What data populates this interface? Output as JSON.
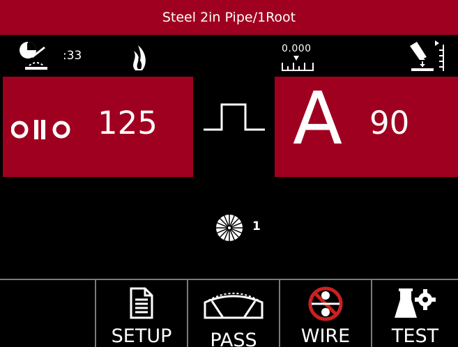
{
  "title": "Steel 2in Pipe/1Root",
  "status": {
    "timer_value": ":33",
    "ruler_value": "0.000",
    "icons": [
      "arc-timer-icon",
      "heat-icon",
      "measure-ruler-icon",
      "stickout-icon"
    ]
  },
  "left_panel": {
    "icon": "wire-feed-speed-icon",
    "value": "125"
  },
  "waveform_icon": "pulse-waveform-icon",
  "right_panel": {
    "letter": "A",
    "value": "90"
  },
  "pass": {
    "icon": "pass-wheel-icon",
    "count": "1"
  },
  "nav": {
    "setup_label": "SETUP",
    "pass_label": "PASS",
    "wire_label": "WIRE",
    "test_label": "TEST"
  },
  "colors": {
    "primary_red": "#a0001f",
    "background": "#000000",
    "divider": "#7a7a7a"
  }
}
